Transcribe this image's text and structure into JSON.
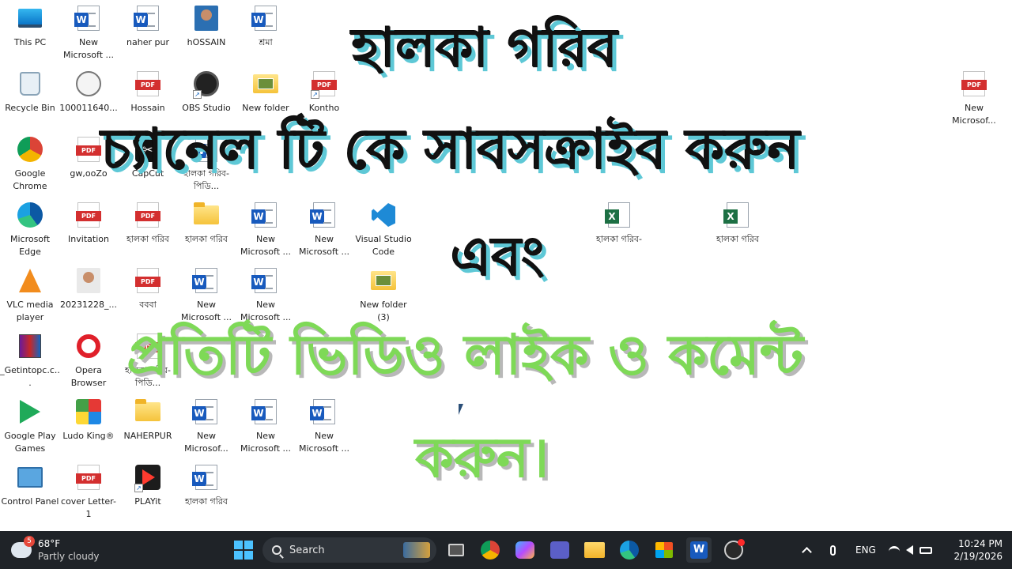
{
  "desktop": {
    "icons": [
      {
        "label": "This PC",
        "icon": "this-pc-icon"
      },
      {
        "label": "New Microsoft ...",
        "icon": "word-document-icon"
      },
      {
        "label": "naher pur",
        "icon": "word-document-icon"
      },
      {
        "label": "hOSSAIN",
        "icon": "photo-avatar-icon"
      },
      {
        "label": "শ্রমা",
        "icon": "word-document-icon"
      },
      {
        "label": "Recycle Bin",
        "icon": "recycle-bin-icon"
      },
      {
        "label": "100011640...",
        "icon": "seal-image-icon"
      },
      {
        "label": "Hossain",
        "icon": "pdf-icon"
      },
      {
        "label": "OBS Studio",
        "icon": "obs-studio-icon"
      },
      {
        "label": "New folder",
        "icon": "folder-icon"
      },
      {
        "label": "Kontho",
        "icon": "shortcut-file-icon"
      },
      {
        "label": "New Microsof...",
        "icon": "pdf-icon"
      },
      {
        "label": "Google Chrome",
        "icon": "chrome-icon"
      },
      {
        "label": "gw,ooZo",
        "icon": "pdf-icon"
      },
      {
        "label": "CapCut",
        "icon": "capcut-icon"
      },
      {
        "label": "হালকা গরিব-পিডি...",
        "icon": "word-document-icon"
      },
      {
        "label": "Microsoft Edge",
        "icon": "edge-icon"
      },
      {
        "label": "Invitation",
        "icon": "pdf-icon"
      },
      {
        "label": "হালকা গরিব",
        "icon": "pdf-icon"
      },
      {
        "label": "হালকা গরিব",
        "icon": "folder-icon"
      },
      {
        "label": "New Microsoft ...",
        "icon": "word-document-icon"
      },
      {
        "label": "New Microsoft ...",
        "icon": "word-document-icon"
      },
      {
        "label": "Visual Studio Code",
        "icon": "vscode-icon"
      },
      {
        "label": "হালকা গরিব-",
        "icon": "excel-icon"
      },
      {
        "label": "হালকা গরিব",
        "icon": "excel-icon"
      },
      {
        "label": "VLC media player",
        "icon": "vlc-icon"
      },
      {
        "label": "20231228_...",
        "icon": "photo-avatar-icon"
      },
      {
        "label": "বববা",
        "icon": "pdf-icon"
      },
      {
        "label": "New Microsoft ...",
        "icon": "word-document-icon"
      },
      {
        "label": "New Microsoft ...",
        "icon": "word-document-icon"
      },
      {
        "label": "New folder (3)",
        "icon": "picture-folder-icon"
      },
      {
        "label": "_Getintopc.c...",
        "icon": "winrar-icon"
      },
      {
        "label": "Opera Browser",
        "icon": "opera-icon"
      },
      {
        "label": "হালকা গরিব-পিডি...",
        "icon": "pdf-icon"
      },
      {
        "label": "Google Play Games",
        "icon": "google-play-games-icon"
      },
      {
        "label": "Ludo King®",
        "icon": "ludo-king-icon"
      },
      {
        "label": "NAHERPUR",
        "icon": "folder-icon"
      },
      {
        "label": "New Microsof...",
        "icon": "word-document-icon"
      },
      {
        "label": "New Microsoft ...",
        "icon": "word-document-icon"
      },
      {
        "label": "New Microsoft ...",
        "icon": "word-document-icon"
      },
      {
        "label": "Control Panel",
        "icon": "control-panel-icon"
      },
      {
        "label": "cover Letter-1",
        "icon": "pdf-icon"
      },
      {
        "label": "PLAYit",
        "icon": "playit-icon"
      },
      {
        "label": "হালকা গরিব",
        "icon": "word-document-icon"
      }
    ]
  },
  "overlay": {
    "line1": "হালকা গরিব",
    "line2": "চ্যানেল টি কে সাবসক্রাইব করুন",
    "line3": "এবং",
    "line4": "প্রতিটি ভিডিও লাইক ও কমেন্ট",
    "line5": "করুন।",
    "dark_color": "#111111",
    "shadow_color": "#5ec8d6",
    "green_color": "#7ed957"
  },
  "taskbar": {
    "weather": {
      "badge": "5",
      "temp": "68°F",
      "condition": "Partly cloudy"
    },
    "search_label": "Search",
    "apps": [
      "windows-start-icon",
      "task-view-icon",
      "chrome-icon",
      "copilot-icon",
      "teams-icon",
      "file-explorer-icon",
      "edge-icon",
      "microsoft-store-icon",
      "word-icon",
      "obs-studio-icon"
    ],
    "language": "ENG",
    "time": "10:24 PM",
    "date": "2/19/2026"
  }
}
